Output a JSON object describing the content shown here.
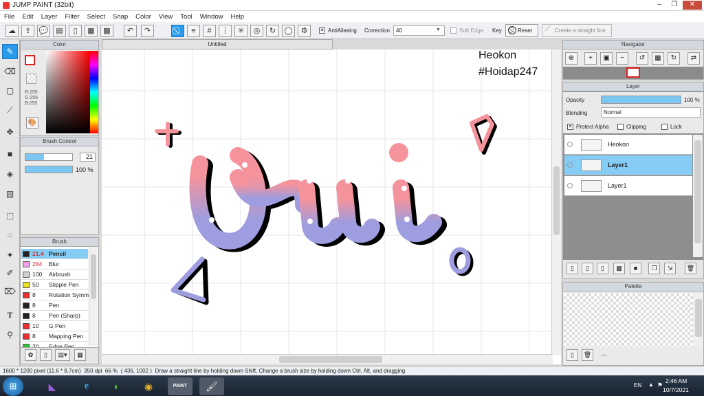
{
  "app": {
    "title": "JUMP PAINT (32bit)"
  },
  "menu": [
    "File",
    "Edit",
    "Layer",
    "Filter",
    "Select",
    "Snap",
    "Color",
    "View",
    "Tool",
    "Window",
    "Help"
  ],
  "toolbar": {
    "antialiasing": "AntiAliasing",
    "correction_label": "Correction",
    "correction_value": "40",
    "soft_edge": "Soft Edge",
    "key_label": "Key",
    "reset": "Reset",
    "straight_line": "Create a straight line"
  },
  "color_panel": {
    "title": "Color",
    "rgb": [
      "R:255",
      "G:255",
      "B:255"
    ]
  },
  "brush_control": {
    "title": "Brush Control",
    "size": "21",
    "opacity": "100 %"
  },
  "brush_panel": {
    "title": "Brush",
    "items": [
      {
        "size": "21.4",
        "name": "Pencil",
        "color": "#222222",
        "selected": true
      },
      {
        "size": "284",
        "name": "Blur",
        "color": "#f0a0e8"
      },
      {
        "size": "100",
        "name": "Airbrush",
        "color": "#cfcfcf"
      },
      {
        "size": "50",
        "name": "Stipple Pen",
        "color": "#e8e020"
      },
      {
        "size": "8",
        "name": "Rotation Symmetry",
        "color": "#e83030"
      },
      {
        "size": "8",
        "name": "Pen",
        "color": "#222222"
      },
      {
        "size": "8",
        "name": "Pen (Sharp)",
        "color": "#222222"
      },
      {
        "size": "10",
        "name": "G Pen",
        "color": "#e83030"
      },
      {
        "size": "8",
        "name": "Mapping Pen",
        "color": "#e83030"
      },
      {
        "size": "20",
        "name": "Edge Pen",
        "color": "#30c030"
      }
    ]
  },
  "document": {
    "tab": "Untitled",
    "text1": "Heokon",
    "text2": "#Hoidap247"
  },
  "navigator": {
    "title": "Navigator"
  },
  "layer_panel": {
    "title": "Layer",
    "opacity_label": "Opacity",
    "opacity_value": "100 %",
    "blending_label": "Blending",
    "blending_value": "Normal",
    "protect_alpha": "Protect Alpha",
    "clipping": "Clipping",
    "lock": "Lock",
    "layers": [
      {
        "name": "Heokon",
        "selected": false
      },
      {
        "name": "Layer1",
        "selected": true
      },
      {
        "name": "Layer1",
        "selected": false
      }
    ]
  },
  "palette": {
    "title": "Palette",
    "dash": "---"
  },
  "status": {
    "size": "1600 * 1200 pixel",
    "cm": "(11.6 * 8.7cm)",
    "dpi": "350 dpi",
    "zoom": "66 %",
    "coords": "( 436, 1002 )",
    "hint": "Draw a straight line by holding down Shift, Change a brush size by holding down Ctrl, Alt, and dragging"
  },
  "taskbar": {
    "lang": "EN",
    "time": "2:46 AM",
    "date": "10/7/2021"
  },
  "colors": {
    "accent": "#2a9bea",
    "pink": "#f4939b",
    "lavender": "#9d9ddf",
    "selected_layer": "#86cdf6"
  }
}
